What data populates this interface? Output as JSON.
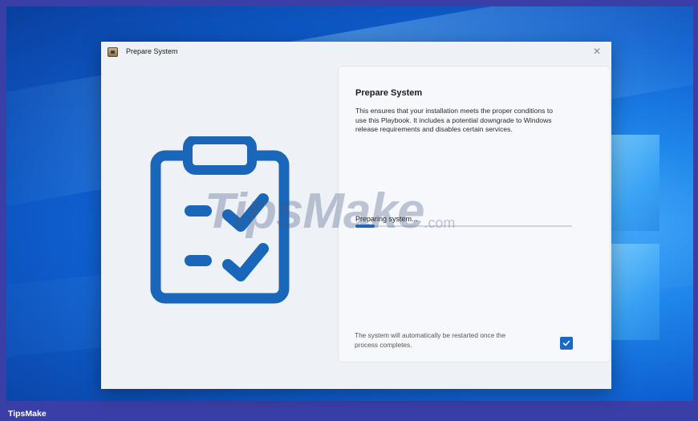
{
  "window": {
    "title": "Prepare System",
    "close_glyph": "✕",
    "icon": "app-package-icon"
  },
  "illustration": {
    "icon": "clipboard-checklist-icon",
    "color": "#1a66b8"
  },
  "card": {
    "title": "Prepare System",
    "description": "This ensures that your installation meets the proper conditions to use this Playbook. It includes a potential downgrade to Windows release requirements and disables certain services.",
    "status": "Preparing system...",
    "progress_fraction": 0.09,
    "restart_note": "The system will automatically be restarted once the process completes.",
    "restart_checked": true
  },
  "watermark": {
    "brand": "TipsMake",
    "suffix": ".com"
  },
  "footer": {
    "label": "TipsMake"
  },
  "colors": {
    "accent": "#1868c8",
    "border_frame": "#3a3fa8"
  }
}
